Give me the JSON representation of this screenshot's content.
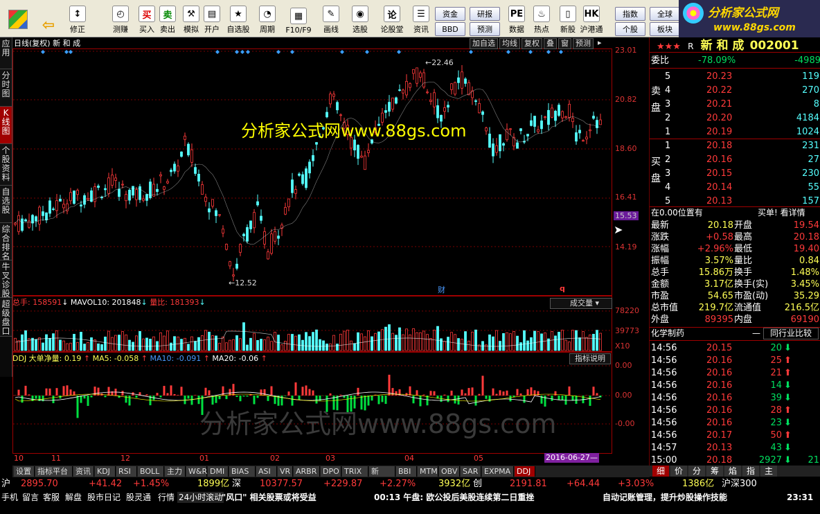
{
  "toolbar": {
    "buttons": [
      {
        "key": "back",
        "label": "",
        "icon": "back-arrow-icon",
        "glyph": "⇦"
      },
      {
        "key": "correct",
        "label": "修正",
        "icon": "updown-icon",
        "glyph": "↕"
      },
      {
        "key": "test",
        "label": "测赚",
        "icon": "clock-icon",
        "glyph": "◴"
      },
      {
        "key": "buy",
        "label": "买入",
        "icon": "buy-icon",
        "glyph": "买"
      },
      {
        "key": "sell",
        "label": "卖出",
        "icon": "sell-icon",
        "glyph": "卖"
      },
      {
        "key": "simulate",
        "label": "模拟",
        "icon": "hammer-icon",
        "glyph": "⚒"
      },
      {
        "key": "open",
        "label": "开户",
        "icon": "id-card-icon",
        "glyph": "▤"
      },
      {
        "key": "favorites",
        "label": "自选股",
        "icon": "star-icon",
        "glyph": "★"
      },
      {
        "key": "period",
        "label": "周期",
        "icon": "period-icon",
        "glyph": "◔"
      },
      {
        "key": "f10",
        "label": "F10/F9",
        "icon": "f10-icon",
        "glyph": "▦"
      },
      {
        "key": "draw",
        "label": "画线",
        "icon": "pen-icon",
        "glyph": "✎"
      },
      {
        "key": "select",
        "label": "选股",
        "icon": "select-icon",
        "glyph": "◉"
      },
      {
        "key": "forum",
        "label": "论股堂",
        "icon": "forum-icon",
        "glyph": "论"
      },
      {
        "key": "news",
        "label": "资讯",
        "icon": "news-icon",
        "glyph": "☰"
      },
      {
        "key": "data",
        "label": "数据",
        "icon": "pe-icon",
        "glyph": "PE"
      },
      {
        "key": "hot",
        "label": "热点",
        "icon": "hot-icon",
        "glyph": "♨"
      },
      {
        "key": "newstock",
        "label": "新股",
        "icon": "newstock-icon",
        "glyph": "▯"
      },
      {
        "key": "hkconnect",
        "label": "沪港通",
        "icon": "hk-icon",
        "glyph": "HK"
      }
    ],
    "small": {
      "funds": "资金",
      "bbd": "BBD",
      "research": "研报",
      "forecast": "预测",
      "index": "指数",
      "board": "个股",
      "global": "全球",
      "sector": "板块"
    }
  },
  "logo": {
    "cn": "分析家公式网",
    "url": "www.88gs.com"
  },
  "left_tabs": [
    "应用",
    "分时图",
    "K线图",
    "个股资料",
    "自选股",
    "综合排名",
    "牛叉诊股",
    "超级盘口"
  ],
  "chart": {
    "title": "日线(复权)",
    "stock": "新 和 成",
    "top_buttons": [
      "加自选",
      "均线",
      "复权",
      "叠",
      "窗",
      "预测"
    ],
    "watermark": "分析家公式网www.88gs.com",
    "watermark2": "分析家公式网www.88gs.com",
    "price_axis": [
      "23.01",
      "20.82",
      "18.60",
      "16.41",
      "15.53",
      "14.19"
    ],
    "high_label": "22.46",
    "low_label": "12.52",
    "cai_label": "财",
    "q_label": "q",
    "vol_header": {
      "total": "总手: 158591",
      "mavol": "MAVOL10: 201848",
      "ratio": "量比: 181393",
      "dropdown": "成交量"
    },
    "vol_axis": [
      "78220",
      "39773",
      "X10"
    ],
    "ddj_header": {
      "name": "DDJ 大单净量: 0.19",
      "ma5": "MA5: -0.058",
      "ma10": "MA10: -0.091",
      "ma20": "MA20: -0.06",
      "explain": "指标说明"
    },
    "ddj_axis": [
      "0.00",
      "0.00",
      "-0.00"
    ],
    "x_labels": [
      "10",
      "11",
      "12",
      "01",
      "02",
      "03",
      "04",
      "05"
    ],
    "cursor_date": "2016-06-27"
  },
  "chart_data": {
    "type": "candlestick",
    "price_range": [
      12.52,
      22.46
    ],
    "price_ticks": [
      23.01,
      20.82,
      18.6,
      16.41,
      14.19
    ],
    "current_price": 15.53,
    "volume_ticks": [
      78220,
      39773
    ],
    "months": [
      "10",
      "11",
      "12",
      "01",
      "02",
      "03",
      "04",
      "05"
    ]
  },
  "quote": {
    "name": "新 和 成",
    "code": "002001",
    "commission": {
      "label": "委比",
      "ratio": "-78.09%",
      "diff": "-4989"
    },
    "sell": [
      {
        "n": "5",
        "p": "20.23",
        "v": "119"
      },
      {
        "n": "4",
        "p": "20.22",
        "v": "270"
      },
      {
        "n": "3",
        "p": "20.21",
        "v": "8"
      },
      {
        "n": "2",
        "p": "20.20",
        "v": "4184"
      },
      {
        "n": "1",
        "p": "20.19",
        "v": "1024"
      }
    ],
    "buy": [
      {
        "n": "1",
        "p": "20.18",
        "v": "231"
      },
      {
        "n": "2",
        "p": "20.16",
        "v": "27"
      },
      {
        "n": "3",
        "p": "20.15",
        "v": "230"
      },
      {
        "n": "4",
        "p": "20.14",
        "v": "55"
      },
      {
        "n": "5",
        "p": "20.13",
        "v": "157"
      }
    ],
    "sell_label": "卖盘",
    "buy_label": "买盘",
    "notice": "在0.00位置有",
    "notice_r": "买单! 看详情",
    "stats": [
      [
        "最新",
        "20.18",
        "开盘",
        "19.54"
      ],
      [
        "涨跌",
        "+0.58",
        "最高",
        "20.18"
      ],
      [
        "涨幅",
        "+2.96%",
        "最低",
        "19.40"
      ],
      [
        "振幅",
        "3.57%",
        "量比",
        "0.84"
      ],
      [
        "总手",
        "15.86万",
        "换手",
        "1.48%"
      ],
      [
        "金额",
        "3.17亿",
        "换手(实)",
        "3.45%"
      ],
      [
        "市盈",
        "54.65",
        "市盈(动)",
        "35.29"
      ],
      [
        "总市值",
        "219.7亿",
        "流通值",
        "216.5亿"
      ],
      [
        "外盘",
        "89395",
        "内盘",
        "69190"
      ]
    ],
    "industry": "化学制药",
    "industry_btn": "同行业比较",
    "ticks": [
      [
        "14:56",
        "20.15",
        "20",
        "dn"
      ],
      [
        "14:56",
        "20.16",
        "25",
        "up"
      ],
      [
        "14:56",
        "20.16",
        "21",
        "up"
      ],
      [
        "14:56",
        "20.16",
        "14",
        "dn"
      ],
      [
        "14:56",
        "20.16",
        "39",
        "dn"
      ],
      [
        "14:56",
        "20.16",
        "28",
        "up"
      ],
      [
        "14:56",
        "20.16",
        "23",
        "dn"
      ],
      [
        "14:56",
        "20.17",
        "50",
        "up"
      ],
      [
        "14:57",
        "20.13",
        "43",
        "dn"
      ],
      [
        "15:00",
        "20.18",
        "2927",
        "dn"
      ]
    ],
    "last_extra": "21",
    "tabs": [
      "细",
      "价",
      "分",
      "筹",
      "焰",
      "指",
      "主"
    ]
  },
  "bottom_tabs": [
    "设置",
    "指标平台",
    "资讯",
    "KDJ",
    "RSI",
    "BOLL",
    "主力",
    "W&R",
    "DMI",
    "BIAS",
    "ASI",
    "VR",
    "ARBR",
    "DPO",
    "TRIX",
    "新DMA",
    "BBI",
    "MTM",
    "OBV",
    "SAR",
    "EXPMA",
    "DDJ"
  ],
  "ticker": {
    "sh": "沪",
    "sh_val": "2895.70",
    "sh_chg": "+41.42",
    "sh_pct": "+1.45%",
    "sh_amt": "1899亿",
    "sz": "深",
    "sz_val": "10377.57",
    "sz_chg": "+229.87",
    "sz_pct": "+2.27%",
    "sz_amt": "3932亿",
    "cy": "创",
    "cy_val": "2191.81",
    "cy_chg": "+64.44",
    "cy_pct": "+3.03%",
    "hs_amt": "1386亿",
    "hs": "沪深300"
  },
  "status": {
    "items": [
      "手机",
      "留言",
      "客服",
      "解盘",
      "股市日记",
      "股灵通",
      "行情"
    ],
    "rolling": "24小时滚动",
    "headline1": "\"风口\" 相关股票或将受益",
    "time_news": "00:13 午盘: 欧公投后美股连续第二日重挫",
    "headline3": "自动记账管理，提升炒股操作技能",
    "clock": "23:31"
  },
  "colors": {
    "up": "#ff3a3a",
    "down": "#55ffff",
    "ma": "#ffffff",
    "accent": "#a00000"
  }
}
